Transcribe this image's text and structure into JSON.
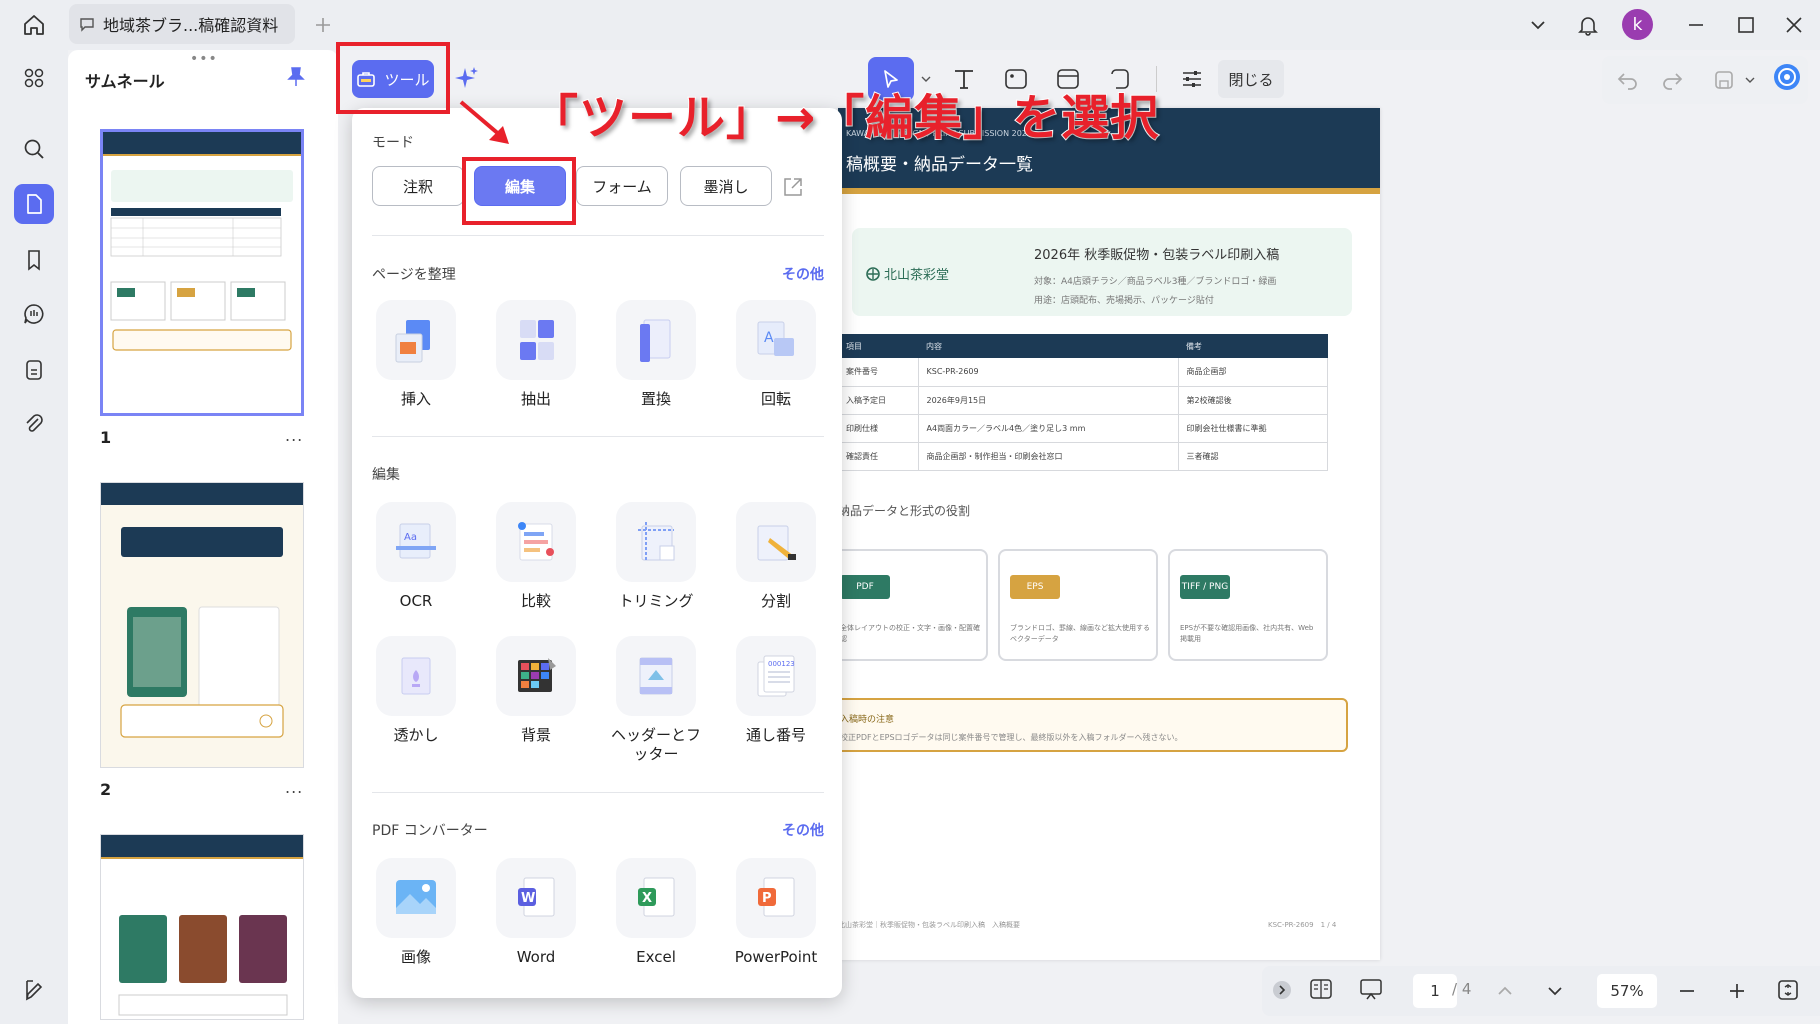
{
  "tab": {
    "title": "地域茶ブラ...稿確認資料"
  },
  "user": {
    "avatar_letter": "k"
  },
  "thumbnails": {
    "title": "サムネール",
    "pages": [
      {
        "number": "1",
        "more": "..."
      },
      {
        "number": "2",
        "more": "..."
      }
    ]
  },
  "toolbar": {
    "tool_label": "ツール",
    "close_label": "閉じる"
  },
  "annotation": {
    "text": "「ツール」→「編集」を選択"
  },
  "popup": {
    "mode_title": "モード",
    "modes": [
      "注釈",
      "編集",
      "フォーム",
      "墨消し"
    ],
    "organize_title": "ページを整理",
    "organize_more": "その他",
    "organize_tools": [
      "挿入",
      "抽出",
      "置換",
      "回転"
    ],
    "edit_title": "編集",
    "edit_tools": [
      "OCR",
      "比較",
      "トリミング",
      "分割",
      "透かし",
      "背景",
      "ヘッダーとフッター",
      "通し番号"
    ],
    "converter_title": "PDF コンバーター",
    "converter_more": "その他",
    "converter_tools": [
      "画像",
      "Word",
      "Excel",
      "PowerPoint"
    ]
  },
  "document": {
    "header_sub": "KAWAHARA DESIGN / PRINT SUBMISSION 2026",
    "header_title": "稿概要・納品データ一覧",
    "brand_name": "北山茶彩堂",
    "brand_title": "2026年 秋季販促物・包装ラベル印刷入稿",
    "brand_target": "対象：A4店頭チラシ／商品ラベル3種／ブランドロゴ・緑画",
    "brand_use": "用途：店頭配布、売場掲示、パッケージ貼付",
    "table_headers": [
      "項目",
      "内容",
      "備考"
    ],
    "table_rows": [
      [
        "案件番号",
        "KSC-PR-2609",
        "商品企画部"
      ],
      [
        "入稿予定日",
        "2026年9月15日",
        "第2校確認後"
      ],
      [
        "印刷仕様",
        "A4両面カラー／ラベル4色／塗り足し3 mm",
        "印刷会社仕様書に準拠"
      ],
      [
        "確認責任",
        "商品企画部・制作担当・印刷会社窓口",
        "三者確認"
      ]
    ],
    "section2_title": "納品データと形式の役割",
    "formats": [
      {
        "badge": "PDF",
        "color": "#2e7a64",
        "desc": "全体レイアウトの校正・文字・画像・配置確認"
      },
      {
        "badge": "EPS",
        "color": "#d6a341",
        "desc": "ブランドロゴ、罫線、線画など拡大使用するベクターデータ"
      },
      {
        "badge": "TIFF / PNG",
        "color": "#2e7a64",
        "desc": "EPSが不要な確認用画像、社内共有、Web掲載用"
      }
    ],
    "note_title": "入稿時の注意",
    "note_text": "校正PDFとEPSロゴデータは同じ案件番号で管理し、最終版以外を入稿フォルダーへ残さない。",
    "footer_left": "北山茶彩堂｜秋季販促物・包装ラベル印刷入稿　入稿概要",
    "footer_right": "KSC-PR-2609　1 / 4"
  },
  "status": {
    "current_page": "1",
    "total_pages": "/ 4",
    "zoom": "57%"
  },
  "colors": {
    "accent": "#5b6cf0",
    "annotation_red": "#e8212b",
    "doc_header": "#1c3a55",
    "doc_gold": "#d6a341"
  }
}
